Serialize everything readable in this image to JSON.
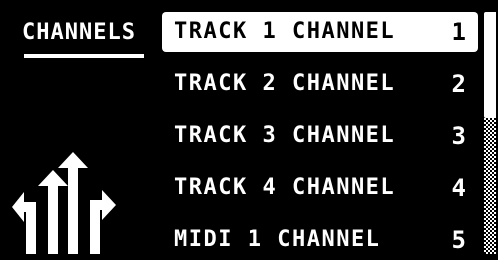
{
  "screen": {
    "title": "CHANNELS",
    "icon": "routing-arrows-icon"
  },
  "channels": [
    {
      "label": "TRACK 1 CHANNEL",
      "value": "1",
      "selected": true
    },
    {
      "label": "TRACK 2 CHANNEL",
      "value": "2",
      "selected": false
    },
    {
      "label": "TRACK 3 CHANNEL",
      "value": "3",
      "selected": false
    },
    {
      "label": "TRACK 4 CHANNEL",
      "value": "4",
      "selected": false
    },
    {
      "label": "MIDI 1 CHANNEL",
      "value": "5",
      "selected": false
    }
  ],
  "colors": {
    "background": "#000000",
    "foreground": "#ffffff"
  }
}
